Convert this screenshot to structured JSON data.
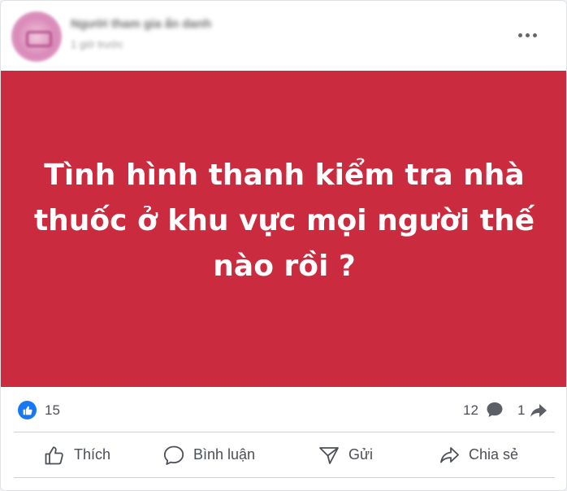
{
  "post": {
    "author": "Người tham gia ẩn danh",
    "timestamp": "1 giờ trước",
    "image_text": "Tình hình thanh kiểm tra nhà thuốc ở khu vực mọi người thế nào rồi ?"
  },
  "stats": {
    "reactions": "15",
    "comments": "12",
    "shares": "1"
  },
  "actions": {
    "like_label": "Thích",
    "comment_label": "Bình luận",
    "send_label": "Gửi",
    "share_label": "Chia sẻ"
  },
  "colors": {
    "post_background": "#cb2b3e",
    "like_blue": "#1877f2",
    "muted_text": "#4b4f56"
  },
  "icons": [
    "avatar",
    "more-icon",
    "like-reaction-icon",
    "comment-icon",
    "share-arrow-icon",
    "thumbs-up-icon",
    "speech-bubble-icon",
    "send-icon",
    "share-icon"
  ]
}
